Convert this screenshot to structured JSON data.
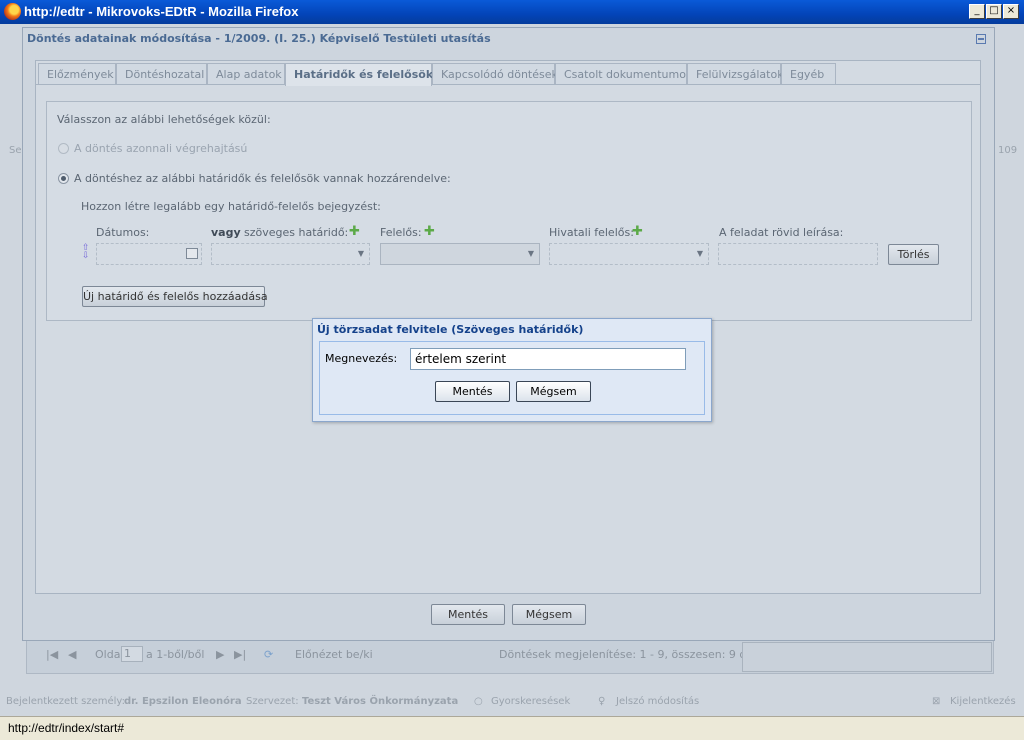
{
  "window": {
    "title": "http://edtr - Mikrovoks-EDtR - Mozilla Firefox",
    "controls": [
      "_",
      "□",
      "×"
    ]
  },
  "background_app": {
    "left_fragment": "Se",
    "right_fragment": "109",
    "pager": {
      "page_label": "Oldal",
      "page_value": "1",
      "of_label": "a 1-ből/ből",
      "preview_label": "Előnézet be/ki",
      "summary": "Döntések megjelenítése: 1 - 9, összesen: 9 db"
    },
    "status": {
      "user_label": "Bejelentkezett személy:",
      "user_name": "dr. Epszilon Eleonóra",
      "org_label": "Szervezet:",
      "org_name": "Teszt Város Önkormányzata",
      "quick_search": "Gyorskeresések",
      "password_change": "Jelszó módosítás",
      "logout": "Kijelentkezés"
    }
  },
  "dialog": {
    "title": "Döntés adatainak módosítása - 1/2009. (I. 25.) Képviselő Testületi utasítás",
    "tabs": [
      {
        "label": "Előzmények"
      },
      {
        "label": "Döntéshozatal"
      },
      {
        "label": "Alap adatok"
      },
      {
        "label": "Határidők és felelősök"
      },
      {
        "label": "Kapcsolódó döntések"
      },
      {
        "label": "Csatolt dokumentumok"
      },
      {
        "label": "Felülvizsgálatok"
      },
      {
        "label": "Egyéb"
      }
    ],
    "form": {
      "prompt": "Válasszon az alábbi lehetőségek közül:",
      "option_immediate": "A döntés azonnali végrehajtású",
      "option_assigned": "A döntéshez az alábbi határidők és felelősök vannak hozzárendelve:",
      "create_hint": "Hozzon létre legalább egy határidő-felelős bejegyzést:",
      "col_date": "Dátumos:",
      "col_text_deadline_bold": "vagy",
      "col_text_deadline": "szöveges határidő:",
      "col_responsible": "Felelős:",
      "col_office_responsible": "Hivatali felelős:",
      "col_description": "A feladat rövid leírása:",
      "delete_button": "Törlés",
      "add_button": "Új határidő és felelős hozzáadása"
    },
    "save_button": "Mentés",
    "cancel_button": "Mégsem"
  },
  "subdialog": {
    "title": "Új törzsadat felvitele (Szöveges határidők)",
    "name_label": "Megnevezés:",
    "name_value": "értelem szerint",
    "save_button": "Mentés",
    "cancel_button": "Mégsem"
  },
  "statusbar": {
    "url": "http://edtr/index/start#"
  }
}
